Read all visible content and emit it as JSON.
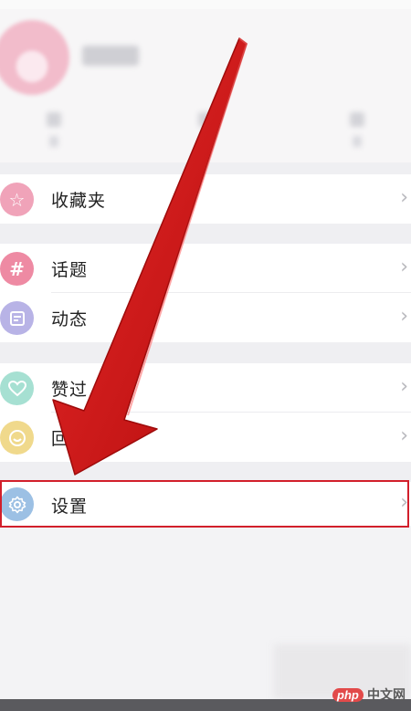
{
  "menu": {
    "favorites": {
      "label": "收藏夹",
      "icon": "star-icon",
      "color": "#f0a3b9"
    },
    "topics": {
      "label": "话题",
      "icon": "hashtag-icon",
      "color": "#ee8aa3"
    },
    "moments": {
      "label": "动态",
      "icon": "note-icon",
      "color": "#b8b3e6"
    },
    "liked": {
      "label": "赞过",
      "icon": "heart-icon",
      "color": "#a6e0d2"
    },
    "replies": {
      "label": "回复",
      "icon": "smile-icon",
      "color": "#f0d98c"
    },
    "settings": {
      "label": "设置",
      "icon": "gear-icon",
      "color": "#9cc0e4"
    }
  },
  "highlight_color": "#d21f2b",
  "watermark": {
    "php": "php",
    "site": "中文网"
  }
}
